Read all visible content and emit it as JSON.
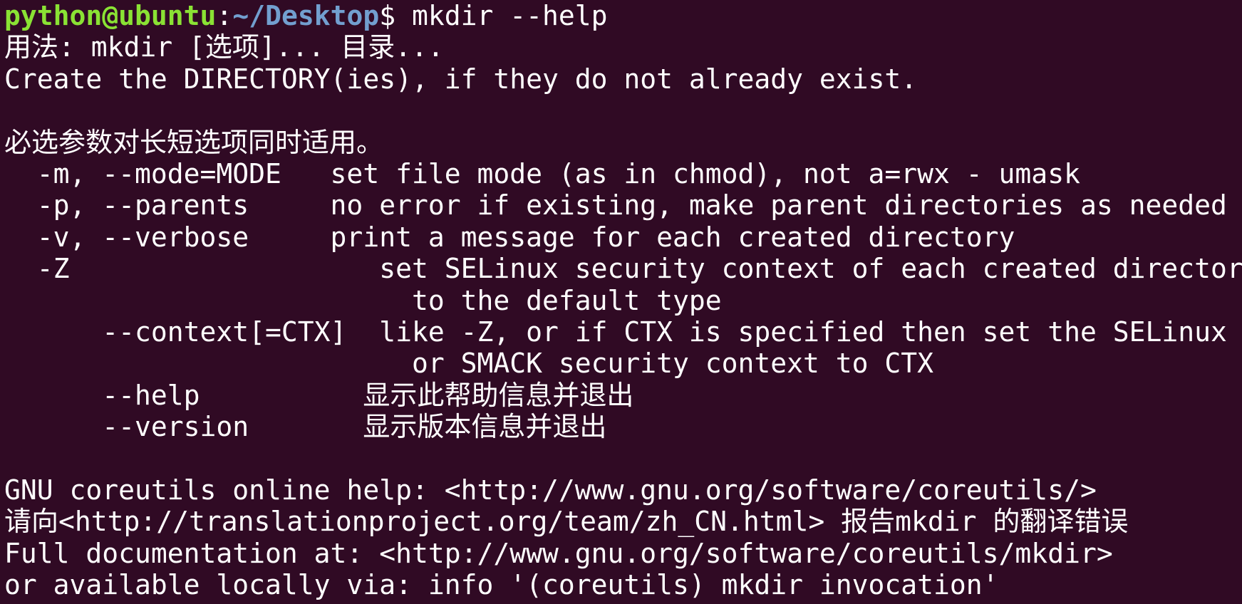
{
  "prompt": {
    "user_host": "python@ubuntu",
    "colon": ":",
    "path": "~/Desktop",
    "dollar": "$ ",
    "command": "mkdir --help"
  },
  "output": {
    "usage": "用法: mkdir [选项]... 目录...",
    "description": "Create the DIRECTORY(ies), if they do not already exist.",
    "blank1": "",
    "mandatory_note": "必选参数对长短选项同时适用。",
    "options": [
      "  -m, --mode=MODE   set file mode (as in chmod), not a=rwx - umask",
      "  -p, --parents     no error if existing, make parent directories as needed",
      "  -v, --verbose     print a message for each created directory",
      "  -Z                   set SELinux security context of each created directory",
      "                         to the default type",
      "      --context[=CTX]  like -Z, or if CTX is specified then set the SELinux",
      "                         or SMACK security context to CTX",
      "      --help          显示此帮助信息并退出",
      "      --version       显示版本信息并退出"
    ],
    "blank2": "",
    "footer": [
      "GNU coreutils online help: <http://www.gnu.org/software/coreutils/>",
      "请向<http://translationproject.org/team/zh_CN.html> 报告mkdir 的翻译错误",
      "Full documentation at: <http://www.gnu.org/software/coreutils/mkdir>",
      "or available locally via: info '(coreutils) mkdir invocation'"
    ]
  },
  "colors": {
    "background": "#300a24",
    "user_host": "#8ae234",
    "path": "#729fcf",
    "text": "#ffffff"
  }
}
